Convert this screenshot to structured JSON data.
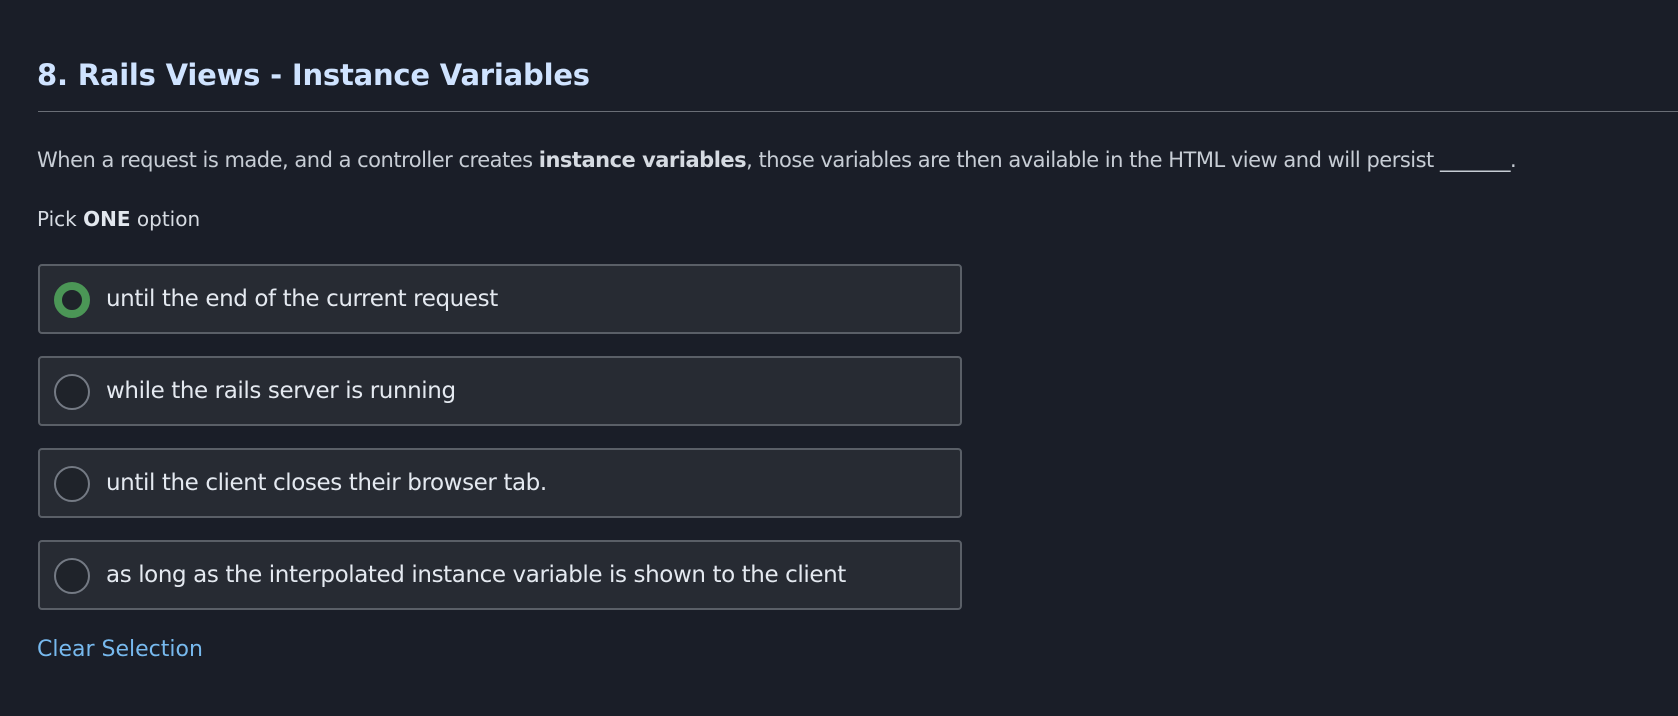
{
  "question": {
    "title": "8. Rails Views - Instance Variables",
    "text_before": "When a request is made, and a controller creates ",
    "emphasis": "instance variables",
    "text_after": ", those variables are then available in the HTML view and will persist _______.",
    "instruction_before": "Pick ",
    "instruction_emphasis": "ONE",
    "instruction_after": " option"
  },
  "options": [
    {
      "label": "until the end of the current request",
      "selected": true
    },
    {
      "label": "while the rails server is running",
      "selected": false
    },
    {
      "label": "until the client closes their browser tab.",
      "selected": false
    },
    {
      "label": "as long as the interpolated instance variable is shown to the client",
      "selected": false
    }
  ],
  "actions": {
    "clear_selection": "Clear Selection"
  },
  "colors": {
    "background": "#1a1e28",
    "title": "#cfe3ff",
    "option_background": "#272b33",
    "option_border": "#5a5f67",
    "selected_radio": "#4b9656",
    "link": "#77b9ee"
  }
}
